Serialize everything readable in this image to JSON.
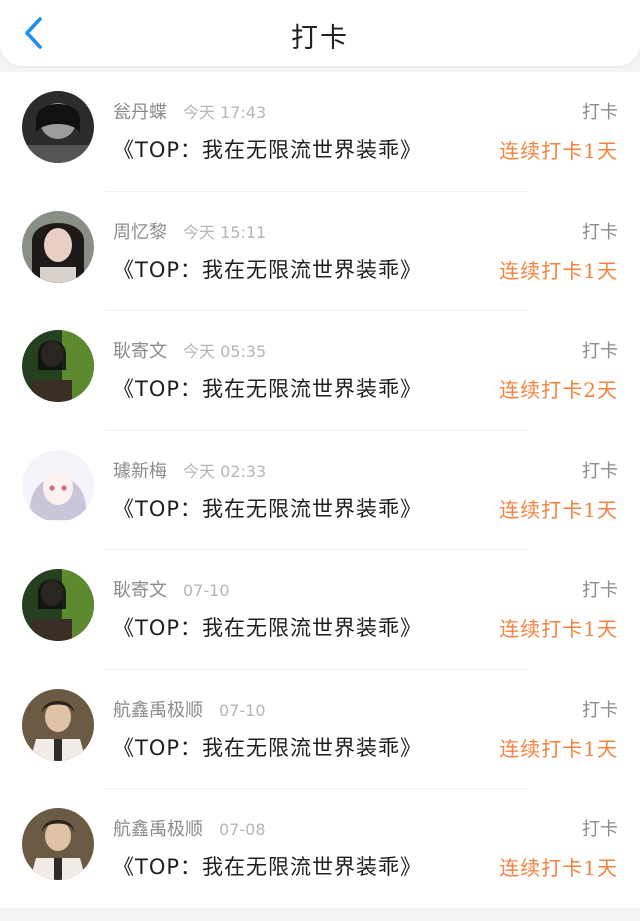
{
  "header": {
    "title": "打卡"
  },
  "colors": {
    "accent": "#1f8ff2",
    "streak": "#f5823d"
  },
  "records": [
    {
      "name": "瓮丹蝶",
      "time": "今天 17:43",
      "tag": "打卡",
      "book_prefix": "《",
      "book_title": "TOP：我在无限流世界装乖",
      "book_suffix": "》",
      "streak": "连续打卡1天"
    },
    {
      "name": "周忆黎",
      "time": "今天 15:11",
      "tag": "打卡",
      "book_prefix": "《",
      "book_title": "TOP：我在无限流世界装乖",
      "book_suffix": "》",
      "streak": "连续打卡1天"
    },
    {
      "name": "耿寄文",
      "time": "今天 05:35",
      "tag": "打卡",
      "book_prefix": "《",
      "book_title": "TOP：我在无限流世界装乖",
      "book_suffix": "》",
      "streak": "连续打卡2天"
    },
    {
      "name": "璩新梅",
      "time": "今天 02:33",
      "tag": "打卡",
      "book_prefix": "《",
      "book_title": "TOP：我在无限流世界装乖",
      "book_suffix": "》",
      "streak": "连续打卡1天"
    },
    {
      "name": "耿寄文",
      "time": "07-10",
      "tag": "打卡",
      "book_prefix": "《",
      "book_title": "TOP：我在无限流世界装乖",
      "book_suffix": "》",
      "streak": "连续打卡1天"
    },
    {
      "name": "航鑫禹极顺",
      "time": "07-10",
      "tag": "打卡",
      "book_prefix": "《",
      "book_title": "TOP：我在无限流世界装乖",
      "book_suffix": "》",
      "streak": "连续打卡1天"
    },
    {
      "name": "航鑫禹极顺",
      "time": "07-08",
      "tag": "打卡",
      "book_prefix": "《",
      "book_title": "TOP：我在无限流世界装乖",
      "book_suffix": "》",
      "streak": "连续打卡1天"
    }
  ]
}
